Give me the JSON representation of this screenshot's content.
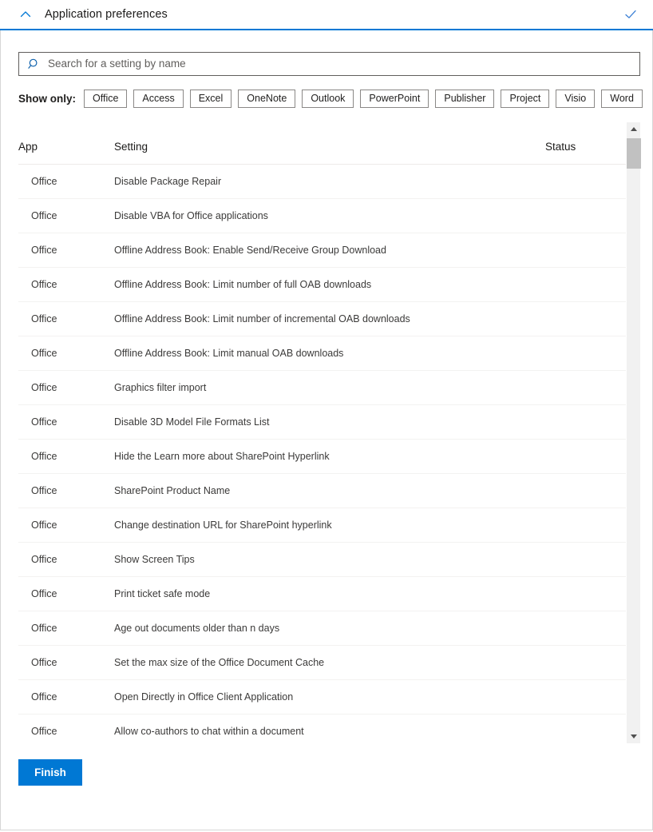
{
  "header": {
    "title": "Application preferences",
    "collapse_icon": "chevron-up-icon",
    "confirm_icon": "checkmark-icon"
  },
  "search": {
    "placeholder": "Search for a setting by name",
    "value": "",
    "icon": "search-icon"
  },
  "filters": {
    "label": "Show only:",
    "buttons": [
      "Office",
      "Access",
      "Excel",
      "OneNote",
      "Outlook",
      "PowerPoint",
      "Publisher",
      "Project",
      "Visio",
      "Word"
    ]
  },
  "table": {
    "columns": [
      "App",
      "Setting",
      "Status"
    ],
    "rows": [
      {
        "app": "Office",
        "setting": "Disable Package Repair",
        "status": ""
      },
      {
        "app": "Office",
        "setting": "Disable VBA for Office applications",
        "status": ""
      },
      {
        "app": "Office",
        "setting": "Offline Address Book: Enable Send/Receive Group Download",
        "status": ""
      },
      {
        "app": "Office",
        "setting": "Offline Address Book: Limit number of full OAB downloads",
        "status": ""
      },
      {
        "app": "Office",
        "setting": "Offline Address Book: Limit number of incremental OAB downloads",
        "status": ""
      },
      {
        "app": "Office",
        "setting": "Offline Address Book: Limit manual OAB downloads",
        "status": ""
      },
      {
        "app": "Office",
        "setting": "Graphics filter import",
        "status": ""
      },
      {
        "app": "Office",
        "setting": "Disable 3D Model File Formats List",
        "status": ""
      },
      {
        "app": "Office",
        "setting": "Hide the Learn more about SharePoint Hyperlink",
        "status": ""
      },
      {
        "app": "Office",
        "setting": "SharePoint Product Name",
        "status": ""
      },
      {
        "app": "Office",
        "setting": "Change destination URL for SharePoint hyperlink",
        "status": ""
      },
      {
        "app": "Office",
        "setting": "Show Screen Tips",
        "status": ""
      },
      {
        "app": "Office",
        "setting": "Print ticket safe mode",
        "status": ""
      },
      {
        "app": "Office",
        "setting": "Age out documents older than n days",
        "status": ""
      },
      {
        "app": "Office",
        "setting": "Set the max size of the Office Document Cache",
        "status": ""
      },
      {
        "app": "Office",
        "setting": "Open Directly in Office Client Application",
        "status": ""
      },
      {
        "app": "Office",
        "setting": "Allow co-authors to chat within a document",
        "status": ""
      }
    ]
  },
  "scrollbar": {
    "up_icon": "scroll-up-arrow-icon",
    "down_icon": "scroll-down-arrow-icon"
  },
  "footer": {
    "finish_label": "Finish"
  },
  "colors": {
    "accent": "#0078d4",
    "header_rule": "#0078d4",
    "border": "#d6d6d6",
    "row_divider": "#f3f2f1",
    "text": "#323130",
    "scroll_thumb": "#c1c1c1",
    "scroll_track": "#f1f1f1"
  }
}
